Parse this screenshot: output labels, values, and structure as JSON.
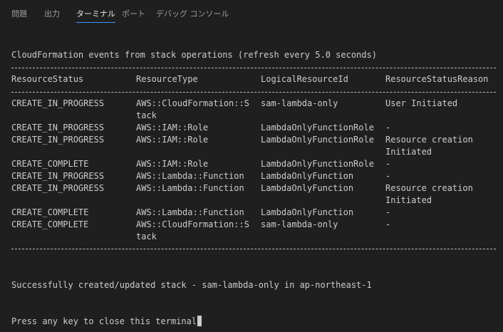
{
  "tabs": [
    {
      "label": "問題"
    },
    {
      "label": "出力"
    },
    {
      "label": "ターミナル"
    },
    {
      "label": "ポート"
    },
    {
      "label": "デバッグ コンソール"
    }
  ],
  "active_tab": "ターミナル",
  "terminal": {
    "heading": "CloudFormation events from stack operations (refresh every 5.0 seconds)",
    "headers": [
      "ResourceStatus",
      "ResourceType",
      "LogicalResourceId",
      "ResourceStatusReason"
    ],
    "rows": [
      [
        "CREATE_IN_PROGRESS",
        "AWS::CloudFormation::S",
        "sam-lambda-only",
        "User Initiated"
      ],
      [
        "",
        "tack",
        "",
        ""
      ],
      [
        "CREATE_IN_PROGRESS",
        "AWS::IAM::Role",
        "LambdaOnlyFunctionRole",
        "-"
      ],
      [
        "CREATE_IN_PROGRESS",
        "AWS::IAM::Role",
        "LambdaOnlyFunctionRole",
        "Resource creation"
      ],
      [
        "",
        "",
        "",
        "Initiated"
      ],
      [
        "CREATE_COMPLETE",
        "AWS::IAM::Role",
        "LambdaOnlyFunctionRole",
        "-"
      ],
      [
        "CREATE_IN_PROGRESS",
        "AWS::Lambda::Function",
        "LambdaOnlyFunction",
        "-"
      ],
      [
        "CREATE_IN_PROGRESS",
        "AWS::Lambda::Function",
        "LambdaOnlyFunction",
        "Resource creation"
      ],
      [
        "",
        "",
        "",
        "Initiated"
      ],
      [
        "CREATE_COMPLETE",
        "AWS::Lambda::Function",
        "LambdaOnlyFunction",
        "-"
      ],
      [
        "CREATE_COMPLETE",
        "AWS::CloudFormation::S",
        "sam-lambda-only",
        "-"
      ],
      [
        "",
        "tack",
        "",
        ""
      ]
    ],
    "success_message": "Successfully created/updated stack - sam-lambda-only in ap-northeast-1",
    "prompt": "Press any key to close this terminal"
  },
  "colors": {
    "background": "#1f1f1f",
    "text": "#cccccc",
    "active_tab_underline": "#3794ff"
  }
}
